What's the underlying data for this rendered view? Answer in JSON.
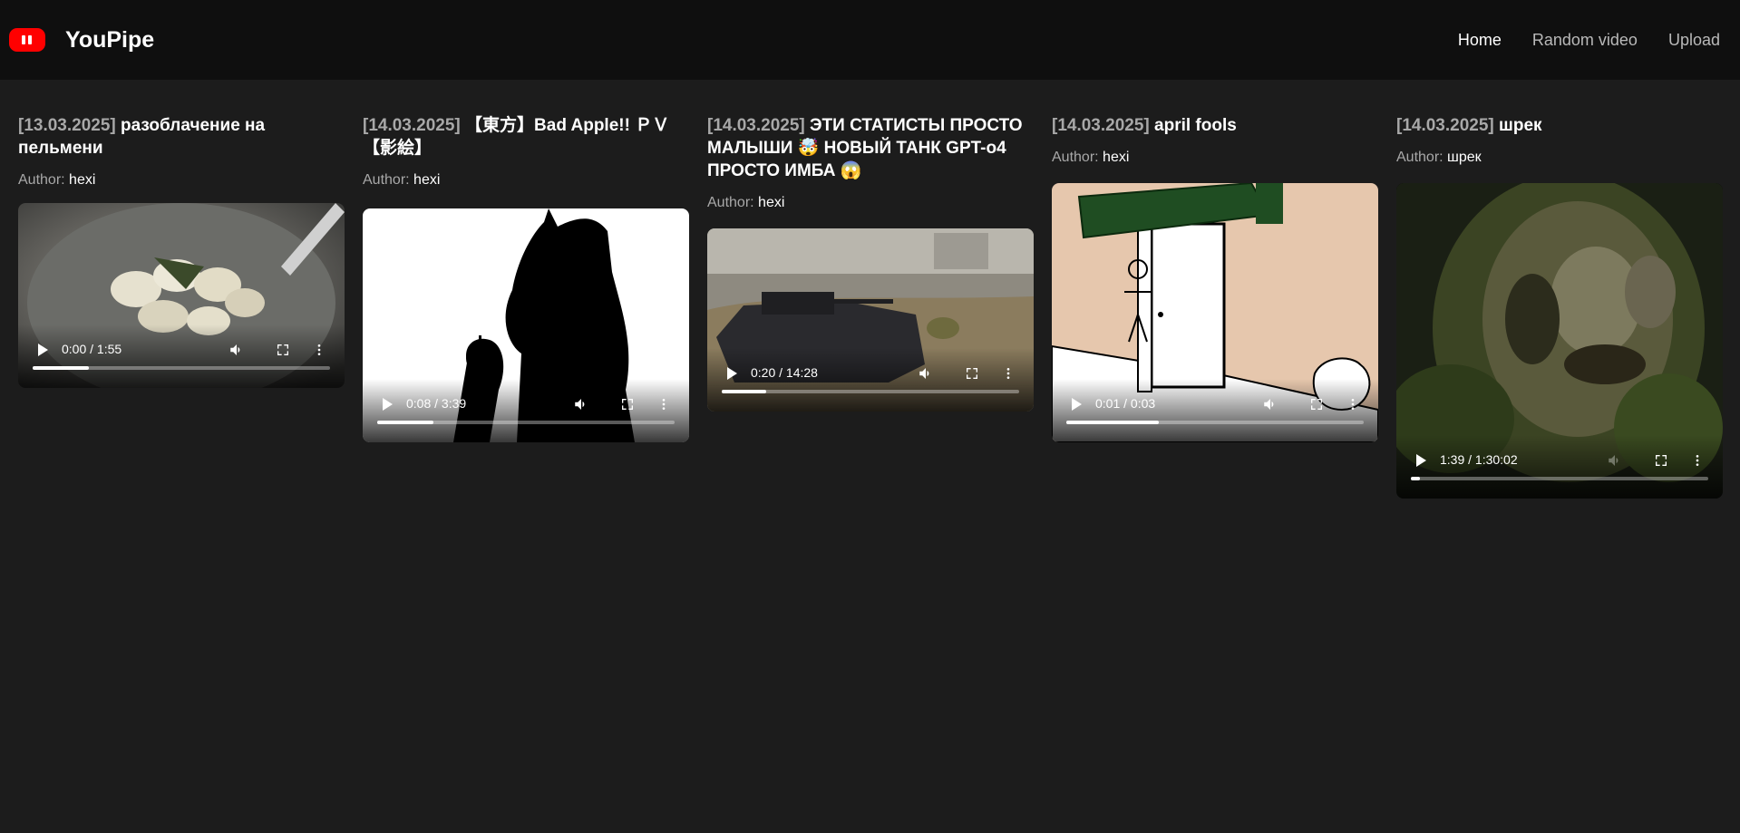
{
  "header": {
    "brand": "YouPipe",
    "logo_icon": "youpipe-logo-icon",
    "accent_color": "#ff0000",
    "nav": [
      {
        "label": "Home",
        "active": true
      },
      {
        "label": "Random video",
        "active": false
      },
      {
        "label": "Upload",
        "active": false
      }
    ]
  },
  "videos": [
    {
      "date": "[13.03.2025]",
      "title": "разоблачение на пельмени",
      "author_label": "Author:",
      "author": "hexi",
      "time": "0:00 / 1:55",
      "progress": 0.19
    },
    {
      "date": "[14.03.2025]",
      "title": "【東方】Bad Apple!! ＰＶ【影絵】",
      "author_label": "Author:",
      "author": "hexi",
      "time": "0:08 / 3:39",
      "progress": 0.19
    },
    {
      "date": "[14.03.2025]",
      "title": "ЭТИ СТАТИСТЫ ПРОСТО МАЛЫШИ 🤯 НОВЫЙ ТАНК GPT-o4 ПРОСТО ИМБА 😱",
      "author_label": "Author:",
      "author": "hexi",
      "time": "0:20 / 14:28",
      "progress": 0.15
    },
    {
      "date": "[14.03.2025]",
      "title": "april fools",
      "author_label": "Author:",
      "author": "hexi",
      "time": "0:01 / 0:03",
      "progress": 0.31
    },
    {
      "date": "[14.03.2025]",
      "title": "шрек",
      "author_label": "Author:",
      "author": "шрек",
      "time": "1:39 / 1:30:02",
      "progress": 0.03
    }
  ]
}
